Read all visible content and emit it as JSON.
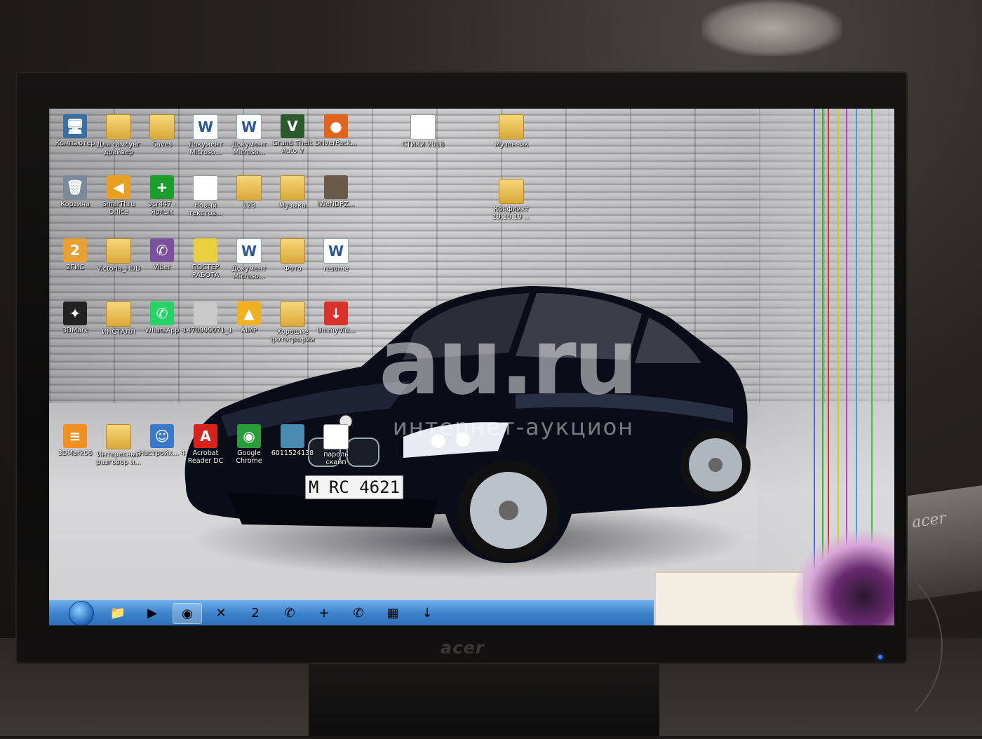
{
  "monitor": {
    "brand": "acer",
    "side_brand": "acer"
  },
  "watermark": {
    "logo": "au.ru",
    "tagline": "интернет-аукцион"
  },
  "car": {
    "plate": "M RC 4621"
  },
  "desktop_icons": [
    {
      "label": "Компьютер",
      "kind": "app",
      "glyph": "🖥",
      "color": "#3a6ea5"
    },
    {
      "label": "Для самсунг драйвер",
      "kind": "folder",
      "glyph": ""
    },
    {
      "label": "Saves",
      "kind": "folder",
      "glyph": ""
    },
    {
      "label": "Документ Microso...",
      "kind": "word",
      "glyph": "W"
    },
    {
      "label": "Документ Microso...",
      "kind": "word",
      "glyph": "W"
    },
    {
      "label": "Grand Theft Auto V",
      "kind": "app",
      "glyph": "V",
      "color": "#2d5a2d"
    },
    {
      "label": "DriverPack...",
      "kind": "app",
      "glyph": "●",
      "color": "#e0641c"
    },
    {
      "label": "СТИХИ 2018",
      "kind": "doc",
      "glyph": ""
    },
    {
      "label": "Музончик",
      "kind": "folder",
      "glyph": ""
    },
    {
      "label": "Корзина",
      "kind": "app",
      "glyph": "🗑",
      "color": "#7a8a9a"
    },
    {
      "label": "SmarThru Office",
      "kind": "app",
      "glyph": "◀",
      "color": "#e8a020"
    },
    {
      "label": "vcr447 - Ярлык",
      "kind": "app",
      "glyph": "+",
      "color": "#1b9e2b"
    },
    {
      "label": "Новый текстов...",
      "kind": "doc",
      "glyph": ""
    },
    {
      "label": "123",
      "kind": "folder",
      "glyph": ""
    },
    {
      "label": "Музыка",
      "kind": "folder",
      "glyph": ""
    },
    {
      "label": "iWeNDPZ...",
      "kind": "app",
      "glyph": "",
      "color": "#6a5a4a"
    },
    {
      "label": "Конфликт 19.10.19 ...",
      "kind": "folder",
      "glyph": ""
    },
    {
      "label": "2ГИС",
      "kind": "app",
      "glyph": "2",
      "color": "#e8a030"
    },
    {
      "label": "Victoria_HDD",
      "kind": "folder",
      "glyph": ""
    },
    {
      "label": "Viber",
      "kind": "app",
      "glyph": "✆",
      "color": "#7b519d"
    },
    {
      "label": "ПОСТЕР РАБОТА",
      "kind": "app",
      "glyph": "",
      "color": "#e8d040"
    },
    {
      "label": "Документ Microso...",
      "kind": "word",
      "glyph": "W"
    },
    {
      "label": "Фото",
      "kind": "folder",
      "glyph": ""
    },
    {
      "label": "resume",
      "kind": "word",
      "glyph": "W"
    },
    {
      "label": "3DMark",
      "kind": "app",
      "glyph": "✦",
      "color": "#222"
    },
    {
      "label": "ИНСТАЛЛ",
      "kind": "folder",
      "glyph": ""
    },
    {
      "label": "WhatsApp",
      "kind": "app",
      "glyph": "✆",
      "color": "#25d366"
    },
    {
      "label": "1470999071_1",
      "kind": "app",
      "glyph": "",
      "color": "#c9c9c9"
    },
    {
      "label": "AIMP",
      "kind": "app",
      "glyph": "▲",
      "color": "#f0b020"
    },
    {
      "label": "Хорошие фотографии",
      "kind": "folder",
      "glyph": ""
    },
    {
      "label": "UmmyVid...",
      "kind": "app",
      "glyph": "↓",
      "color": "#d9312b"
    },
    {
      "label": "3DMark06",
      "kind": "app",
      "glyph": "≡",
      "color": "#f09020"
    },
    {
      "label": "Интересный разговор и...",
      "kind": "folder",
      "glyph": ""
    },
    {
      "label": "Настройк... 4",
      "kind": "app",
      "glyph": "☺",
      "color": "#3a78c8"
    },
    {
      "label": "Acrobat Reader DC",
      "kind": "app",
      "glyph": "A",
      "color": "#d6231d"
    },
    {
      "label": "Google Chrome",
      "kind": "app",
      "glyph": "◉",
      "color": "#2a9d3a"
    },
    {
      "label": "6011524138",
      "kind": "app",
      "glyph": "",
      "color": "#4a8ab0"
    },
    {
      "label": "пароль скайп",
      "kind": "doc",
      "glyph": ""
    }
  ],
  "taskbar": {
    "items": [
      {
        "name": "explorer",
        "glyph": "📁"
      },
      {
        "name": "media-player",
        "glyph": "▶"
      },
      {
        "name": "chrome",
        "glyph": "◉"
      },
      {
        "name": "tools",
        "glyph": "✕"
      },
      {
        "name": "2gis",
        "glyph": "2"
      },
      {
        "name": "viber",
        "glyph": "✆"
      },
      {
        "name": "vcr447",
        "glyph": "+"
      },
      {
        "name": "whatsapp",
        "glyph": "✆"
      },
      {
        "name": "calculator",
        "glyph": "▦"
      },
      {
        "name": "ummy",
        "glyph": "↓"
      }
    ]
  }
}
